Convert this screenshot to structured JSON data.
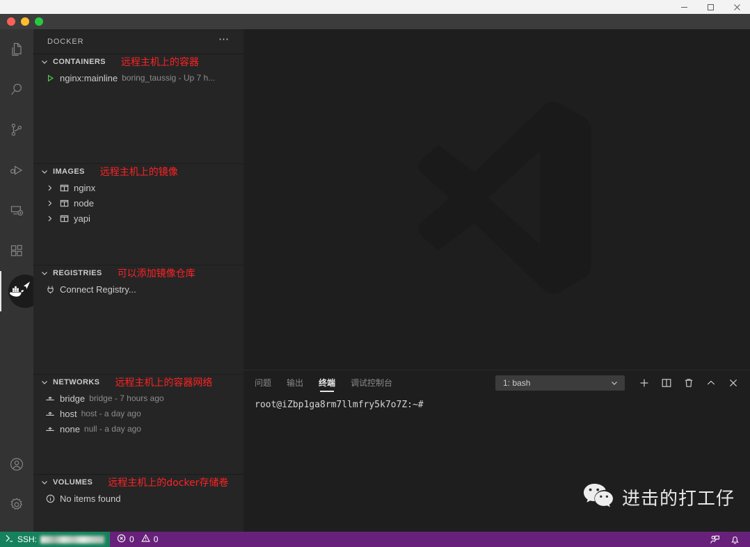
{
  "os_window": {
    "minimize_label": "minimize",
    "maximize_label": "maximize",
    "close_label": "close"
  },
  "activity_bar": {
    "items": [
      {
        "name": "explorer",
        "title": "Explorer"
      },
      {
        "name": "search",
        "title": "Search"
      },
      {
        "name": "source-control",
        "title": "Source Control"
      },
      {
        "name": "run-debug",
        "title": "Run and Debug"
      },
      {
        "name": "remote-explorer",
        "title": "Remote Explorer"
      },
      {
        "name": "extensions",
        "title": "Extensions"
      },
      {
        "name": "docker",
        "title": "Docker"
      }
    ],
    "bottom_items": [
      {
        "name": "accounts",
        "title": "Accounts"
      },
      {
        "name": "settings",
        "title": "Manage"
      }
    ]
  },
  "sidebar": {
    "title": "DOCKER",
    "more_actions": "⋯",
    "sections": [
      {
        "title": "CONTAINERS",
        "annotation": "远程主机上的容器",
        "rows": [
          {
            "label": "nginx:mainline",
            "description": "boring_taussig - Up 7 h...",
            "icon": "play-icon"
          }
        ]
      },
      {
        "title": "IMAGES",
        "annotation": "远程主机上的镜像",
        "rows": [
          {
            "label": "nginx",
            "description": "",
            "icon": "image-icon"
          },
          {
            "label": "node",
            "description": "",
            "icon": "image-icon"
          },
          {
            "label": "yapi",
            "description": "",
            "icon": "image-icon"
          }
        ]
      },
      {
        "title": "REGISTRIES",
        "annotation": "可以添加镜像仓库",
        "rows": [
          {
            "label": "Connect Registry...",
            "description": "",
            "icon": "plug-icon"
          }
        ]
      },
      {
        "title": "NETWORKS",
        "annotation": "远程主机上的容器网络",
        "rows": [
          {
            "label": "bridge",
            "description": "bridge - 7 hours ago",
            "icon": "network-icon"
          },
          {
            "label": "host",
            "description": "host - a day ago",
            "icon": "network-icon"
          },
          {
            "label": "none",
            "description": "null - a day ago",
            "icon": "network-icon"
          }
        ]
      },
      {
        "title": "VOLUMES",
        "annotation": "远程主机上的docker存储卷",
        "rows": [
          {
            "label": "No items found",
            "description": "",
            "icon": "info-icon"
          }
        ]
      }
    ]
  },
  "panel": {
    "tabs": [
      {
        "label": "问题",
        "active": false
      },
      {
        "label": "输出",
        "active": false
      },
      {
        "label": "终端",
        "active": true
      },
      {
        "label": "调试控制台",
        "active": false
      }
    ],
    "terminal_select_value": "1: bash",
    "actions": [
      {
        "name": "new-terminal-button",
        "label": "+"
      },
      {
        "name": "split-terminal-button",
        "label": "split"
      },
      {
        "name": "kill-terminal-button",
        "label": "trash"
      },
      {
        "name": "maximize-panel-button",
        "label": "chevron-up"
      },
      {
        "name": "close-panel-button",
        "label": "close"
      }
    ],
    "terminal_prompt": "root@iZbp1ga8rm7llmfry5k7o7Z:~#"
  },
  "watermark": {
    "wechat_name": "进击的打工仔"
  },
  "status_bar": {
    "remote_label": "SSH:",
    "errors": "0",
    "warnings": "0",
    "colors": {
      "background": "#68217a",
      "remote": "#16825d"
    }
  }
}
